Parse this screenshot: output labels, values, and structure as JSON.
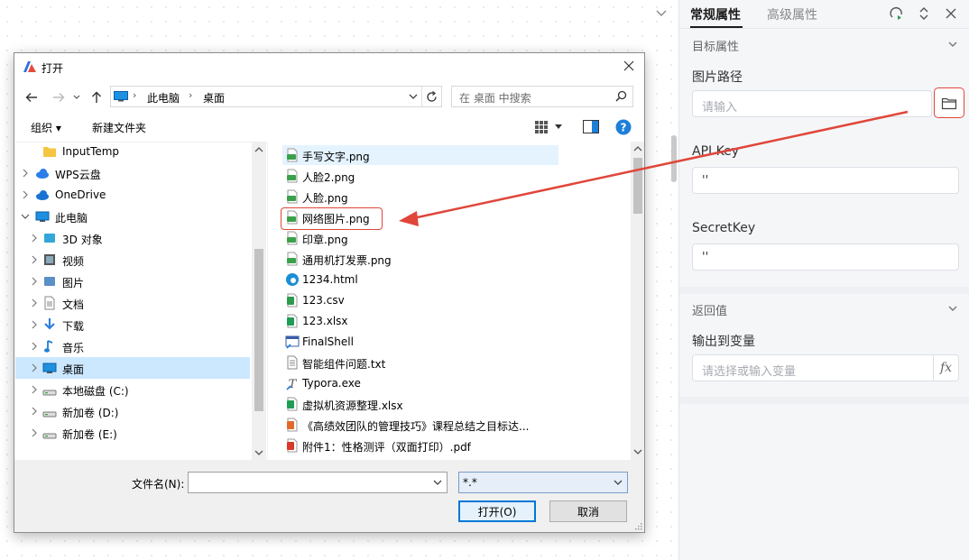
{
  "panel": {
    "tabs": [
      "常规属性",
      "高级属性"
    ],
    "section_target": "目标属性",
    "image_path_label": "图片路径",
    "image_path_placeholder": "请输入",
    "api_key_label": "API Key",
    "api_key_value": "''",
    "secret_key_label": "SecretKey",
    "secret_key_value": "''",
    "section_return": "返回值",
    "output_label": "输出到变量",
    "output_placeholder": "请选择或输入变量",
    "fx_label": "fx"
  },
  "dialog": {
    "title": "打开",
    "breadcrumb": [
      "此电脑",
      "桌面"
    ],
    "search_placeholder": "在 桌面 中搜索",
    "organize_label": "组织 ▾",
    "new_folder_label": "新建文件夹",
    "nav_items": [
      {
        "label": "InputTemp",
        "icon": "folder-icon",
        "indent": 2
      },
      {
        "label": "WPS云盘",
        "icon": "wps-cloud-icon",
        "indent": 1
      },
      {
        "label": "OneDrive",
        "icon": "onedrive-icon",
        "indent": 1
      },
      {
        "label": "此电脑",
        "icon": "pc-icon",
        "indent": 1
      },
      {
        "label": "3D 对象",
        "icon": "3d-objects-icon",
        "indent": 2
      },
      {
        "label": "视频",
        "icon": "video-icon",
        "indent": 2
      },
      {
        "label": "图片",
        "icon": "pictures-icon",
        "indent": 2
      },
      {
        "label": "文档",
        "icon": "documents-icon",
        "indent": 2
      },
      {
        "label": "下载",
        "icon": "downloads-icon",
        "indent": 2
      },
      {
        "label": "音乐",
        "icon": "music-icon",
        "indent": 2
      },
      {
        "label": "桌面",
        "icon": "desktop-icon",
        "indent": 2
      },
      {
        "label": "本地磁盘 (C:)",
        "icon": "drive-c-icon",
        "indent": 2
      },
      {
        "label": "新加卷 (D:)",
        "icon": "drive-icon",
        "indent": 2
      },
      {
        "label": "新加卷 (E:)",
        "icon": "drive-icon",
        "indent": 2
      }
    ],
    "files": [
      {
        "name": "手写文字.png",
        "icon": "png-file-icon"
      },
      {
        "name": "人脸2.png",
        "icon": "png-file-icon"
      },
      {
        "name": "人脸.png",
        "icon": "png-file-icon"
      },
      {
        "name": "网络图片.png",
        "icon": "png-file-icon"
      },
      {
        "name": "印章.png",
        "icon": "png-file-icon"
      },
      {
        "name": "通用机打发票.png",
        "icon": "png-file-icon"
      },
      {
        "name": "1234.html",
        "icon": "edge-html-icon"
      },
      {
        "name": "123.csv",
        "icon": "csv-file-icon"
      },
      {
        "name": "123.xlsx",
        "icon": "xlsx-file-icon"
      },
      {
        "name": "FinalShell",
        "icon": "shortcut-app-icon"
      },
      {
        "name": "智能组件问题.txt",
        "icon": "txt-file-icon"
      },
      {
        "name": "Typora.exe",
        "icon": "exe-file-icon"
      },
      {
        "name": "虚拟机资源整理.xlsx",
        "icon": "xlsx-file-icon"
      },
      {
        "name": "《高绩效团队的管理技巧》课程总结之目标达...",
        "icon": "ppt-file-icon"
      },
      {
        "name": "附件1：性格测评（双面打印）.pdf",
        "icon": "pdf-file-icon"
      }
    ],
    "filename_label": "文件名(N):",
    "filename_value": "",
    "filter_value": "*.*",
    "open_label": "打开(O)",
    "cancel_label": "取消"
  },
  "colors": {
    "annotation_red": "#e0463a",
    "selection_blue": "#cce8ff",
    "primary_button_border": "#0078d7"
  }
}
